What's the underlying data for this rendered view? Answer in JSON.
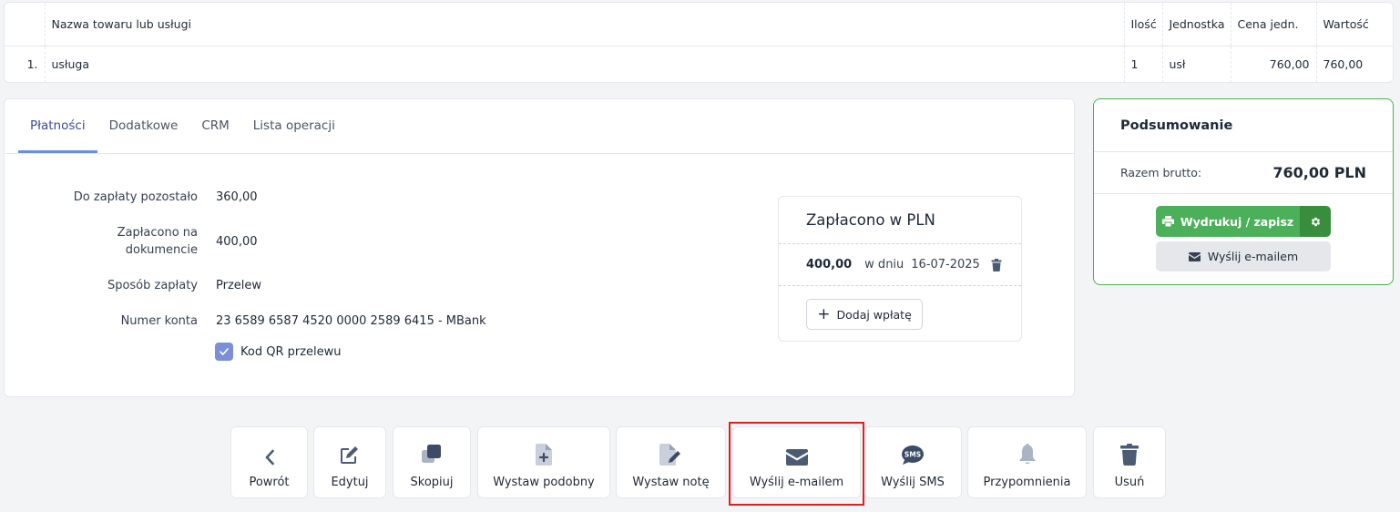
{
  "items_table": {
    "headers": [
      "",
      "Nazwa towaru lub usługi",
      "Ilość",
      "Jednostka",
      "Cena jedn.",
      "Wartość"
    ],
    "rows": [
      {
        "lp": "1.",
        "name": "usługa",
        "qty": "1",
        "unit": "usł",
        "price": "760,00",
        "value": "760,00"
      }
    ]
  },
  "tabs": [
    "Płatności",
    "Dodatkowe",
    "CRM",
    "Lista operacji"
  ],
  "payment": {
    "remaining_label": "Do zapłaty pozostało",
    "remaining_value": "360,00",
    "paid_label": "Zapłacono na dokumencie",
    "paid_value": "400,00",
    "method_label": "Sposób zapłaty",
    "method_value": "Przelew",
    "account_label": "Numer konta",
    "account_value": "23 6589 6587 4520 0000 2589 6415 - MBank",
    "qr_label": "Kod QR przelewu",
    "qr_checked": true
  },
  "paid_card": {
    "title": "Zapłacono w PLN",
    "amount": "400,00",
    "on_day": "w dniu",
    "date": "16-07-2025",
    "add_label": "Dodaj wpłatę"
  },
  "summary": {
    "title": "Podsumowanie",
    "gross_label": "Razem brutto:",
    "gross_value": "760,00 PLN",
    "print_label": "Wydrukuj / zapisz",
    "email_label": "Wyślij e-mailem"
  },
  "actions": [
    {
      "label": "Powrót",
      "icon": "chevron-left-icon"
    },
    {
      "label": "Edytuj",
      "icon": "edit-icon"
    },
    {
      "label": "Skopiuj",
      "icon": "copy-icon"
    },
    {
      "label": "Wystaw podobny",
      "icon": "file-plus-icon"
    },
    {
      "label": "Wystaw notę",
      "icon": "file-edit-icon"
    },
    {
      "label": "Wyślij e-mailem",
      "icon": "envelope-icon"
    },
    {
      "label": "Wyślij SMS",
      "icon": "sms-icon"
    },
    {
      "label": "Przypomnienia",
      "icon": "bell-icon"
    },
    {
      "label": "Usuń",
      "icon": "trash-icon"
    }
  ],
  "colors": {
    "accent_green": "#4caf5a",
    "tab_active": "#3b4a9c",
    "highlight": "#e02020",
    "icon_gray": "#4b5b73"
  }
}
